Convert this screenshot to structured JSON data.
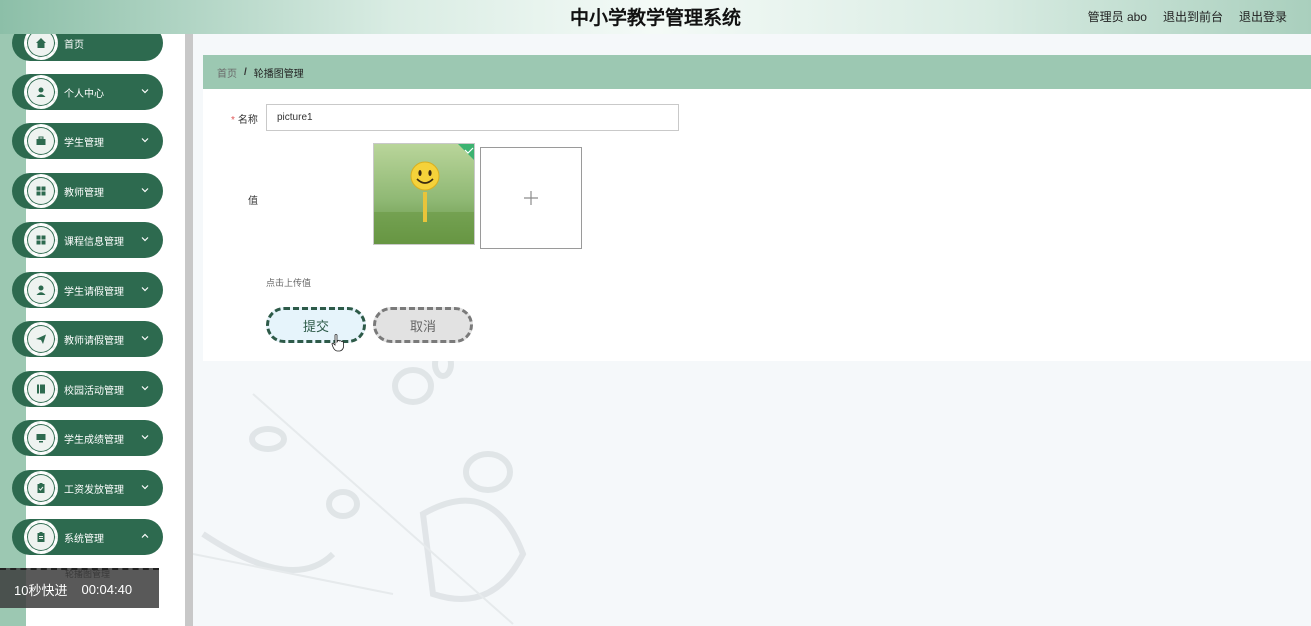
{
  "header": {
    "title": "中小学教学管理系统",
    "admin_label": "管理员 abo",
    "to_front_label": "退出到前台",
    "logout_label": "退出登录"
  },
  "sidebar": {
    "items": [
      {
        "label": "首页",
        "icon": "home-icon"
      },
      {
        "label": "个人中心",
        "icon": "user-icon"
      },
      {
        "label": "学生管理",
        "icon": "briefcase-icon"
      },
      {
        "label": "教师管理",
        "icon": "grid-icon"
      },
      {
        "label": "课程信息管理",
        "icon": "grid-icon"
      },
      {
        "label": "学生请假管理",
        "icon": "user-icon"
      },
      {
        "label": "教师请假管理",
        "icon": "send-icon"
      },
      {
        "label": "校园活动管理",
        "icon": "book-icon"
      },
      {
        "label": "学生成绩管理",
        "icon": "monitor-icon"
      },
      {
        "label": "工资发放管理",
        "icon": "clipboard-icon"
      },
      {
        "label": "系统管理",
        "icon": "clipboard-icon"
      }
    ],
    "sub_item": "轮播图管理"
  },
  "video_overlay": {
    "skip_label": "10秒快进",
    "time": "00:04:40"
  },
  "breadcrumb": {
    "home": "首页",
    "separator": "/",
    "current": "轮播图管理"
  },
  "form": {
    "name_required": "*",
    "name_label": "名称",
    "name_value": "picture1",
    "value_label": "值",
    "upload_hint": "点击上传值",
    "submit_label": "提交",
    "cancel_label": "取消"
  },
  "colors": {
    "primary": "#2d6a4f",
    "accent_light": "#9cc8b2",
    "submit_bg": "#e6f4fb"
  }
}
